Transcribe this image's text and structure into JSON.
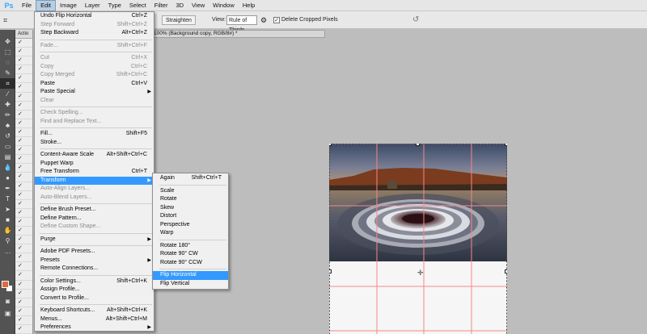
{
  "app": {
    "logo": "Ps"
  },
  "menubar": [
    "File",
    "Edit",
    "Image",
    "Layer",
    "Type",
    "Select",
    "Filter",
    "3D",
    "View",
    "Window",
    "Help"
  ],
  "options": {
    "straighten": "Straighten",
    "view_label": "View:",
    "view_value": "Rule of Thirds",
    "checkbox_mark": "✓",
    "delete_cropped": "Delete Cropped Pixels"
  },
  "panel": {
    "tab": "Actio",
    "checks": [
      "✓",
      "✓",
      "✓",
      "✓",
      "✓",
      "✓",
      "✓",
      "✓",
      "✓",
      "✓",
      "✓",
      "✓",
      "✓",
      "✓",
      "✓",
      "✓",
      "✓",
      "✓",
      "✓",
      "✓",
      "✓",
      "✓",
      "✓",
      "✓",
      "✓",
      "✓",
      "✓",
      "✓",
      "✓",
      "✓",
      "✓",
      "✓",
      "✓"
    ]
  },
  "document": {
    "tab_title": "100% (Background copy, RGB/8#) *"
  },
  "edit_menu": {
    "g1": [
      {
        "label": "Undo Flip Horizontal",
        "shortcut": "Ctrl+Z",
        "disabled": false
      },
      {
        "label": "Step Forward",
        "shortcut": "Shift+Ctrl+Z",
        "disabled": true
      },
      {
        "label": "Step Backward",
        "shortcut": "Alt+Ctrl+Z",
        "disabled": false
      }
    ],
    "g2": [
      {
        "label": "Fade...",
        "shortcut": "Shift+Ctrl+F",
        "disabled": true
      }
    ],
    "g3": [
      {
        "label": "Cut",
        "shortcut": "Ctrl+X",
        "disabled": true
      },
      {
        "label": "Copy",
        "shortcut": "Ctrl+C",
        "disabled": true
      },
      {
        "label": "Copy Merged",
        "shortcut": "Shift+Ctrl+C",
        "disabled": true
      },
      {
        "label": "Paste",
        "shortcut": "Ctrl+V",
        "disabled": false
      },
      {
        "label": "Paste Special",
        "shortcut": "",
        "disabled": false,
        "submenu": true
      },
      {
        "label": "Clear",
        "shortcut": "",
        "disabled": true
      }
    ],
    "g4": [
      {
        "label": "Check Spelling...",
        "shortcut": "",
        "disabled": true
      },
      {
        "label": "Find and Replace Text...",
        "shortcut": "",
        "disabled": true
      }
    ],
    "g5": [
      {
        "label": "Fill...",
        "shortcut": "Shift+F5",
        "disabled": false
      },
      {
        "label": "Stroke...",
        "shortcut": "",
        "disabled": false
      }
    ],
    "g6": [
      {
        "label": "Content-Aware Scale",
        "shortcut": "Alt+Shift+Ctrl+C",
        "disabled": false
      },
      {
        "label": "Puppet Warp",
        "shortcut": "",
        "disabled": false
      },
      {
        "label": "Free Transform",
        "shortcut": "Ctrl+T",
        "disabled": false
      },
      {
        "label": "Transform",
        "shortcut": "",
        "disabled": false,
        "submenu": true,
        "highlighted": true
      },
      {
        "label": "Auto-Align Layers...",
        "shortcut": "",
        "disabled": true
      },
      {
        "label": "Auto-Blend Layers...",
        "shortcut": "",
        "disabled": true
      }
    ],
    "g7": [
      {
        "label": "Define Brush Preset...",
        "shortcut": "",
        "disabled": false
      },
      {
        "label": "Define Pattern...",
        "shortcut": "",
        "disabled": false
      },
      {
        "label": "Define Custom Shape...",
        "shortcut": "",
        "disabled": true
      }
    ],
    "g8": [
      {
        "label": "Purge",
        "shortcut": "",
        "disabled": false,
        "submenu": true
      }
    ],
    "g9": [
      {
        "label": "Adobe PDF Presets...",
        "shortcut": "",
        "disabled": false
      },
      {
        "label": "Presets",
        "shortcut": "",
        "disabled": false,
        "submenu": true
      },
      {
        "label": "Remote Connections...",
        "shortcut": "",
        "disabled": false
      }
    ],
    "g10": [
      {
        "label": "Color Settings...",
        "shortcut": "Shift+Ctrl+K",
        "disabled": false
      },
      {
        "label": "Assign Profile...",
        "shortcut": "",
        "disabled": false
      },
      {
        "label": "Convert to Profile...",
        "shortcut": "",
        "disabled": false
      }
    ],
    "g11": [
      {
        "label": "Keyboard Shortcuts...",
        "shortcut": "Alt+Shift+Ctrl+K",
        "disabled": false
      },
      {
        "label": "Menus...",
        "shortcut": "Alt+Shift+Ctrl+M",
        "disabled": false
      },
      {
        "label": "Preferences",
        "shortcut": "",
        "disabled": false,
        "submenu": true
      }
    ]
  },
  "transform_menu": {
    "g1": [
      {
        "label": "Again",
        "shortcut": "Shift+Ctrl+T"
      }
    ],
    "g2": [
      {
        "label": "Scale"
      },
      {
        "label": "Rotate"
      },
      {
        "label": "Skew"
      },
      {
        "label": "Distort"
      },
      {
        "label": "Perspective"
      },
      {
        "label": "Warp"
      }
    ],
    "g3": [
      {
        "label": "Rotate 180°"
      },
      {
        "label": "Rotate 90° CW"
      },
      {
        "label": "Rotate 90° CCW"
      }
    ],
    "g4": [
      {
        "label": "Flip Horizontal",
        "highlighted": true
      },
      {
        "label": "Flip Vertical"
      }
    ]
  },
  "colors": {
    "highlight": "#3399ff",
    "foreground": "#e0693a",
    "grid": "#f08a8a"
  }
}
